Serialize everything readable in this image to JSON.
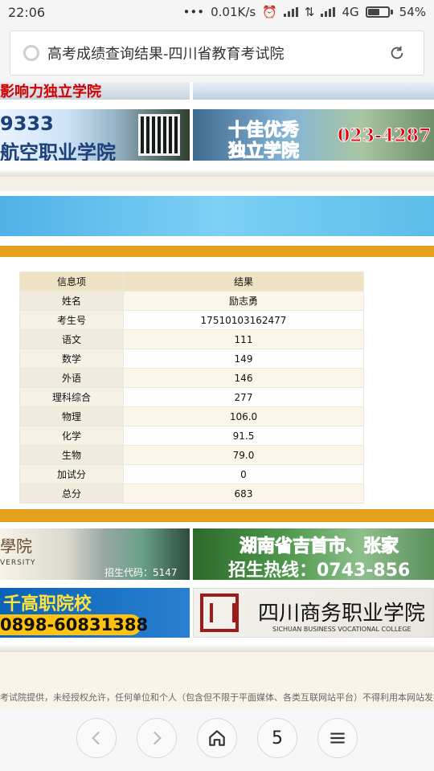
{
  "status_bar": {
    "time": "22:06",
    "speed": "0.01K/s",
    "network": "4G",
    "battery": "54%",
    "battery_level": 0.54
  },
  "browser": {
    "title": "高考成绩查询结果-四川省教育考试院",
    "tab_count": "5"
  },
  "ads": {
    "top_left_text": "影响力独立学院",
    "mid_left_number": "9333",
    "mid_left_name": "航空职业学院",
    "mid_right_line1": "十佳优秀",
    "mid_right_line2": "独立学院",
    "mid_right_phone": "023-4287",
    "bottom_left_calligraphy": "學院",
    "bottom_left_english": "VERSITY",
    "bottom_left_code": "招生代码：5147",
    "bottom_right_line1": "湖南省吉首市、张家",
    "bottom_right_line2": "招生热线：0743-856",
    "last_left_line1": "千高职院校",
    "last_left_phone": "0898-60831388",
    "last_right_name": "四川商务职业学院",
    "last_right_english": "SICHUAN BUSINESS VOCATIONAL COLLEGE"
  },
  "results": {
    "header": [
      "信息项",
      "结果"
    ],
    "rows": [
      [
        "姓名",
        "励志勇"
      ],
      [
        "考生号",
        "17510103162477"
      ],
      [
        "语文",
        "111"
      ],
      [
        "数学",
        "149"
      ],
      [
        "外语",
        "146"
      ],
      [
        "理科综合",
        "277"
      ],
      [
        "物理",
        "106.0"
      ],
      [
        "化学",
        "91.5"
      ],
      [
        "生物",
        "79.0"
      ],
      [
        "加试分",
        "0"
      ],
      [
        "总分",
        "683"
      ]
    ]
  },
  "footer": {
    "note": "考试院提供，未经授权允许，任何单位和个人（包含但不限于平面媒体、各类互联网站平台）不得利用本网站发布的信息用"
  }
}
